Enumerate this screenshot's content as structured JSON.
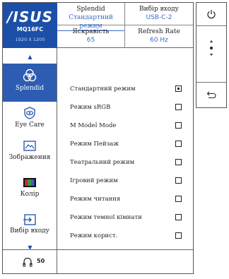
{
  "brand": {
    "logo": "/ISUS",
    "model": "MQ16FC",
    "resolution": "1920 X 1200"
  },
  "header": {
    "splendid_label": "Splendid",
    "splendid_value": "Стандартний режим",
    "input_label": "Вибір входу",
    "input_value": "USB-C-2",
    "brightness_label": "Яскравість",
    "brightness_value": "65",
    "refresh_label": "Refresh Rate",
    "refresh_value": "60 Hz"
  },
  "nav": {
    "items": [
      {
        "label": "Splendid",
        "icon": "splendid-icon",
        "active": true
      },
      {
        "label": "Eye Care",
        "icon": "eye-care-icon",
        "active": false
      },
      {
        "label": "Зображення",
        "icon": "image-icon",
        "active": false
      },
      {
        "label": "Колір",
        "icon": "color-icon",
        "active": false
      },
      {
        "label": "Вибір входу",
        "icon": "input-select-icon",
        "active": false
      }
    ]
  },
  "modes": [
    {
      "label": "Стандартний режим",
      "selected": true
    },
    {
      "label": "Режим sRGB",
      "selected": false
    },
    {
      "label": "M Model Mode",
      "selected": false
    },
    {
      "label": "Режим Пейзаж",
      "selected": false
    },
    {
      "label": "Театральний режим",
      "selected": false
    },
    {
      "label": "Ігровий режим",
      "selected": false
    },
    {
      "label": "Режим читання",
      "selected": false
    },
    {
      "label": "Режим темної кімнати",
      "selected": false
    },
    {
      "label": "Режим корист.",
      "selected": false
    }
  ],
  "footer": {
    "volume": "50",
    "volume_icon": "headphones-icon"
  },
  "side_controls": [
    "power-icon",
    "menu-dots-icon",
    "back-icon"
  ],
  "colors": {
    "accent": "#1c4fa8",
    "active_bg": "#2d5cb3",
    "value_text": "#3a6cc8"
  }
}
